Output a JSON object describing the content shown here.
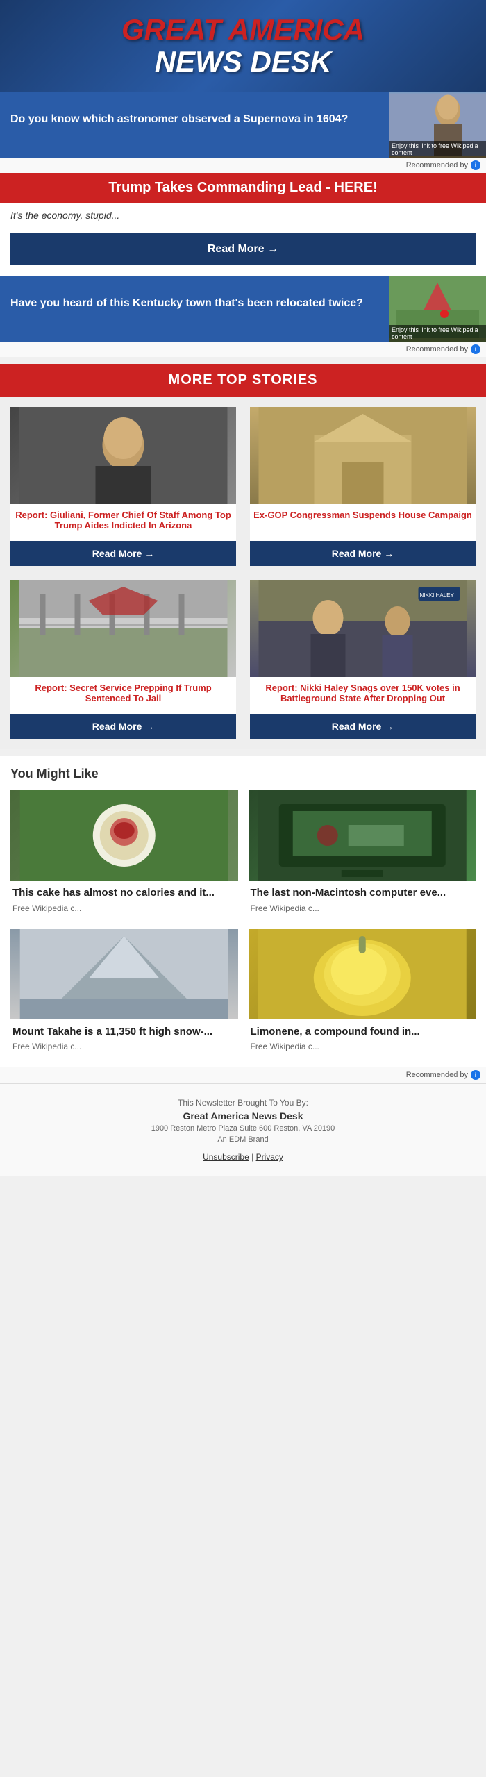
{
  "header": {
    "line1": "Great America",
    "line2": "News Desk"
  },
  "wiki_promo_1": {
    "question": "Do you know which astronomer observed a Supernova in 1604?",
    "caption": "Enjoy this link to free Wikipedia content",
    "recommended_by": "Recommended by",
    "rec_icon": "i"
  },
  "headline_article": {
    "title": "Trump Takes Commanding Lead - HERE!",
    "subtitle": "It's the economy, stupid...",
    "read_more": "Read More →"
  },
  "wiki_promo_2": {
    "question": "Have you heard of this Kentucky town that's been relocated twice?",
    "caption": "Enjoy this link to free Wikipedia content",
    "recommended_by": "Recommended by",
    "rec_icon": "i"
  },
  "more_top_stories": {
    "section_label": "MORE TOP STORIES",
    "stories": [
      {
        "title": "Report: Giuliani, Former Chief Of Staff Among Top Trump Aides Indicted In Arizona",
        "read_more": "Read More →"
      },
      {
        "title": "Ex-GOP Congressman Suspends House Campaign",
        "read_more": "Read More →"
      },
      {
        "title": "Report: Secret Service Prepping If Trump Sentenced To Jail",
        "read_more": "Read More →"
      },
      {
        "title": "Report: Nikki Haley Snags over 150K votes in Battleground State After Dropping Out",
        "read_more": "Read More →"
      }
    ]
  },
  "you_might_like": {
    "section_label": "You Might Like",
    "items": [
      {
        "title": "This cake has almost no calories and it...",
        "source": "Free Wikipedia c..."
      },
      {
        "title": "The last non-Macintosh computer eve...",
        "source": "Free Wikipedia c..."
      },
      {
        "title": "Mount Takahe is a 11,350 ft high snow-...",
        "source": "Free Wikipedia c..."
      },
      {
        "title": "Limonene, a compound found in...",
        "source": "Free Wikipedia c..."
      }
    ],
    "recommended_by": "Recommended by",
    "rec_icon": "i"
  },
  "footer": {
    "brought_to_you_by": "This Newsletter Brought To You By:",
    "brand": "Great America News Desk",
    "address": "1900 Reston Metro Plaza Suite 600 Reston, VA 20190",
    "edm": "An EDM Brand",
    "unsubscribe": "Unsubscribe",
    "pipe": "|",
    "privacy": "Privacy"
  }
}
